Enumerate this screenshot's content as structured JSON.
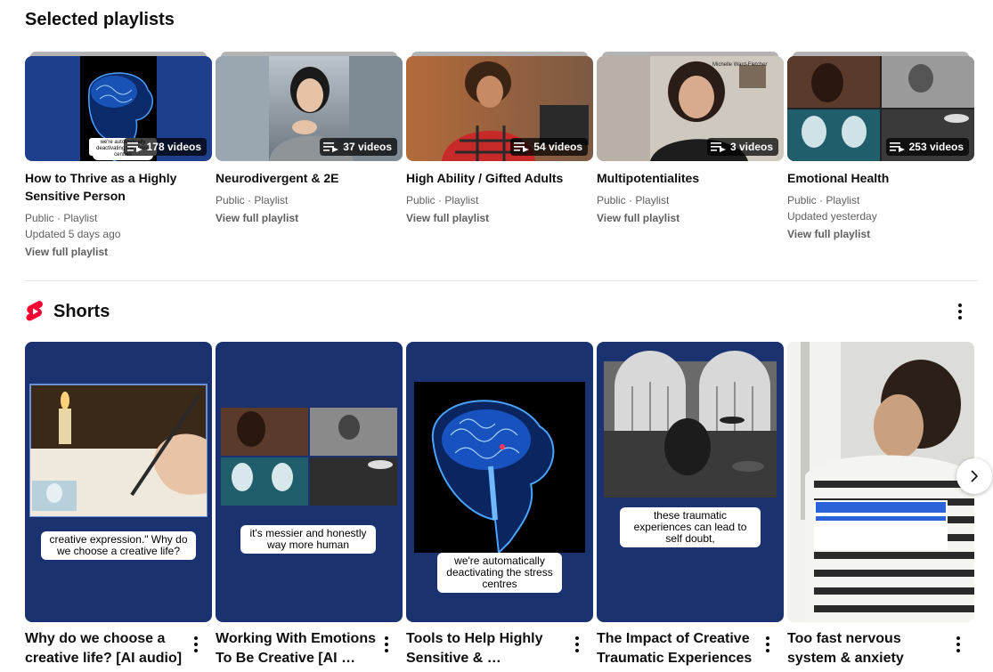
{
  "playlists": {
    "heading": "Selected playlists",
    "items": [
      {
        "title": "How to Thrive as a Highly Sensitive Person",
        "visibility": "Public · Playlist",
        "updated": "Updated 5 days ago",
        "count": "178 videos",
        "link": "View full playlist",
        "thumb_text": "we're automatically deactivating the stress centres"
      },
      {
        "title": "Neurodivergent & 2E",
        "visibility": "Public · Playlist",
        "count": "37 videos",
        "link": "View full playlist"
      },
      {
        "title": "High Ability / Gifted Adults",
        "visibility": "Public · Playlist",
        "count": "54 videos",
        "link": "View full playlist"
      },
      {
        "title": "Multipotentialites",
        "visibility": "Public · Playlist",
        "count": "3 videos",
        "link": "View full playlist",
        "thumb_text": "Michelle Ward-Fletcher"
      },
      {
        "title": "Emotional Health",
        "visibility": "Public · Playlist",
        "updated": "Updated yesterday",
        "count": "253 videos",
        "link": "View full playlist"
      }
    ]
  },
  "shorts": {
    "heading": "Shorts",
    "items": [
      {
        "title": "Why do we choose a creative life? [AI audio]",
        "caption": "creative expression.\"  Why do we choose a creative life?"
      },
      {
        "title": "Working With Emotions To Be Creative [AI …",
        "caption": "it's messier and honestly way more human"
      },
      {
        "title": "Tools to Help Highly Sensitive & …",
        "caption": "we're automatically deactivating the stress centres"
      },
      {
        "title": "The Impact of Creative Traumatic Experiences",
        "caption": "these traumatic experiences can lead to self doubt,"
      },
      {
        "title": "Too fast nervous system & anxiety"
      }
    ]
  },
  "colors": {
    "shorts_red": "#ff0033",
    "short_bg": "#1b3270",
    "meta_gray": "#606060"
  }
}
